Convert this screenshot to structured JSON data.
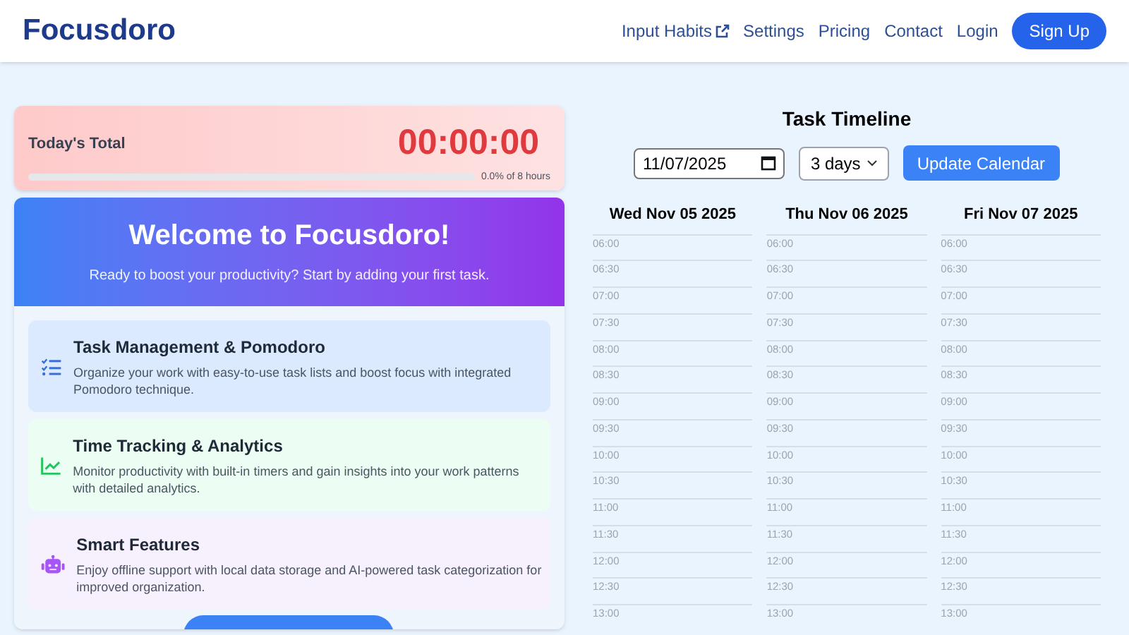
{
  "header": {
    "logo": "Focusdoro",
    "nav": [
      {
        "label": "Input Habits",
        "external": true
      },
      {
        "label": "Settings",
        "external": false
      },
      {
        "label": "Pricing",
        "external": false
      },
      {
        "label": "Contact",
        "external": false
      },
      {
        "label": "Login",
        "external": false
      }
    ],
    "signup": "Sign Up"
  },
  "today": {
    "label": "Today's Total",
    "time": "00:00:00",
    "level": 0,
    "reading": "0.0% of 8 hours"
  },
  "welcome": {
    "title": "Welcome to Focusdoro!",
    "subtitle": "Ready to boost your productivity? Start by adding your first task.",
    "features": [
      {
        "kind": "tasks",
        "title": "Task Management & Pomodoro",
        "text": "Organize your work with easy-to-use task lists and boost focus with integrated Pomodoro technique."
      },
      {
        "kind": "analytics",
        "title": "Time Tracking & Analytics",
        "text": "Monitor productivity with built-in timers and gain insights into your work patterns with detailed analytics."
      },
      {
        "kind": "smart",
        "title": "Smart Features",
        "text": "Enjoy offline support with local data storage and AI-powered task categorization for improved organization."
      }
    ]
  },
  "timeline": {
    "title": "Task Timeline",
    "date": "11/07/2025",
    "range": "3 days",
    "update": "Update Calendar",
    "days": [
      {
        "label": "Wed Nov 05 2025",
        "slots": [
          "06:00",
          "06:30",
          "07:00",
          "07:30",
          "08:00",
          "08:30",
          "09:00",
          "09:30",
          "10:00",
          "10:30",
          "11:00",
          "11:30",
          "12:00",
          "12:30",
          "13:00"
        ]
      },
      {
        "label": "Thu Nov 06 2025",
        "slots": [
          "06:00",
          "06:30",
          "07:00",
          "07:30",
          "08:00",
          "08:30",
          "09:00",
          "09:30",
          "10:00",
          "10:30",
          "11:00",
          "11:30",
          "12:00",
          "12:30",
          "13:00"
        ]
      },
      {
        "label": "Fri Nov 07 2025",
        "slots": [
          "06:00",
          "06:30",
          "07:00",
          "07:30",
          "08:00",
          "08:30",
          "09:00",
          "09:30",
          "10:00",
          "10:30",
          "11:00",
          "11:30",
          "12:00",
          "12:30",
          "13:00"
        ]
      }
    ]
  }
}
